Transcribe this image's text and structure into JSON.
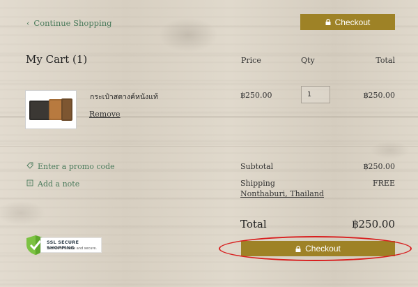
{
  "header": {
    "continue_label": "Continue Shopping",
    "checkout_label": "Checkout"
  },
  "cart": {
    "title": "My Cart (1)",
    "columns": {
      "price": "Price",
      "qty": "Qty",
      "total": "Total"
    },
    "items": [
      {
        "name": "กระเป๋าสตางค์หนังแท้",
        "remove_label": "Remove",
        "price": "฿250.00",
        "qty": "1",
        "total": "฿250.00"
      }
    ]
  },
  "extras": {
    "promo_label": "Enter a promo code",
    "note_label": "Add a note"
  },
  "summary": {
    "subtotal_label": "Subtotal",
    "subtotal_value": "฿250.00",
    "shipping_label": "Shipping",
    "shipping_value": "FREE",
    "shipping_location": "Nonthaburi, Thailand",
    "total_label": "Total",
    "total_value": "฿250.00",
    "checkout_label": "Checkout"
  },
  "badge": {
    "ssl_title": "SSL  SECURE SHOPPING",
    "ssl_sub": "Your data is safe and secure."
  },
  "colors": {
    "accent": "#9e8226",
    "link": "#4a7a5b",
    "annotation": "#d81e1e"
  }
}
